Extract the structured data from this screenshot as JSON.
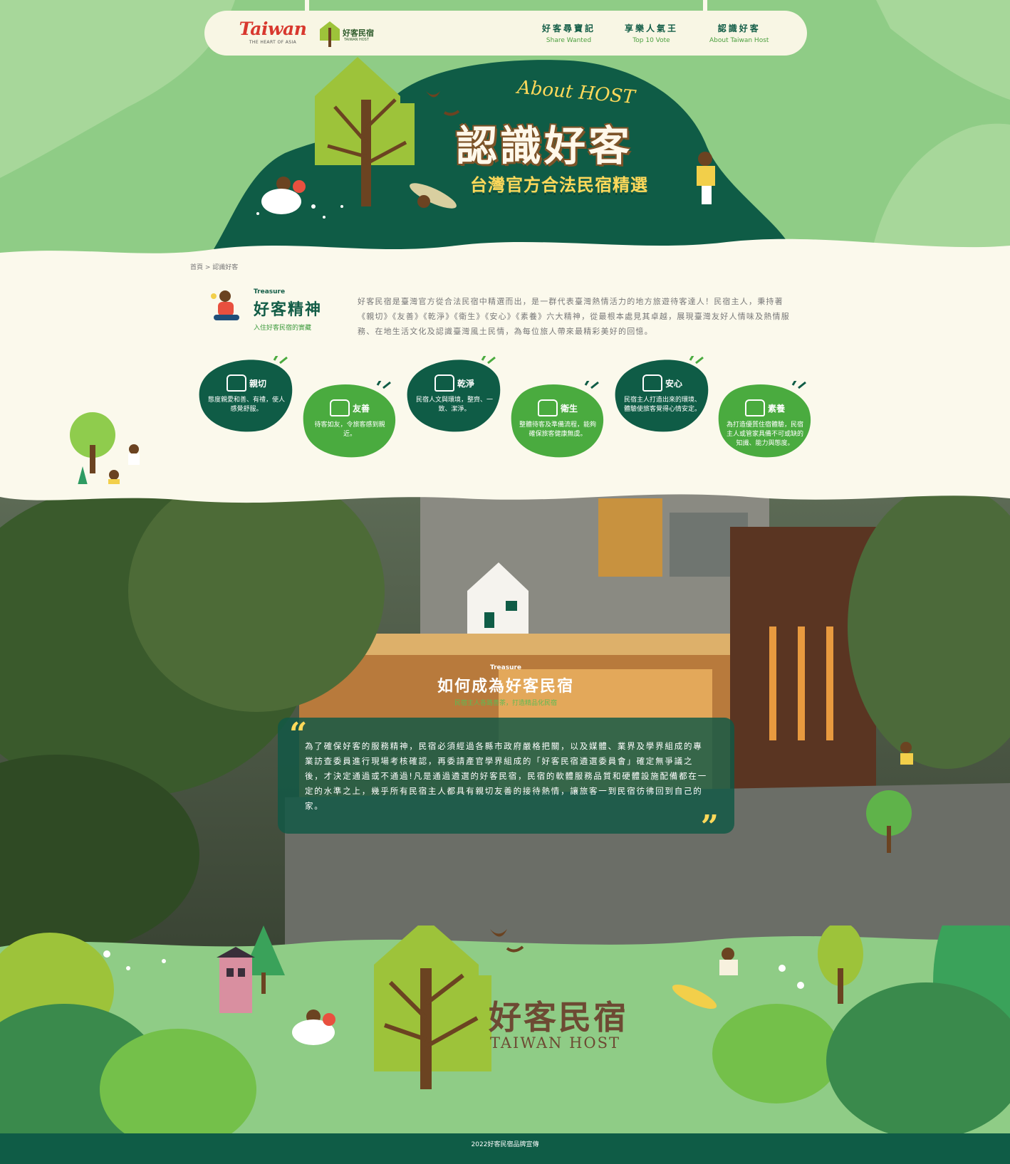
{
  "nav": {
    "logo_taiwan": "Taiwan",
    "logo_taiwan_sub": "THE HEART OF ASIA",
    "logo_host_zh": "好客民宿",
    "logo_host_en": "TAIWAN HOST",
    "items": [
      {
        "zh": "好客尋寶記",
        "en": "Share Wanted"
      },
      {
        "zh": "享樂人氣王",
        "en": "Top 10 Vote"
      },
      {
        "zh": "認識好客",
        "en": "About Taiwan Host"
      }
    ]
  },
  "hero": {
    "about": "About HOST",
    "title": "認識好客",
    "subtitle": "台灣官方合法民宿精選"
  },
  "breadcrumb": {
    "home": "首頁",
    "sep": " > ",
    "current": "認識好客"
  },
  "spirit": {
    "tag": "Treasure",
    "title": "好客精神",
    "subtitle": "入住好客民宿的實藏",
    "description": "好客民宿是臺灣官方從合法民宿中精選而出，是一群代表臺灣熱情活力的地方旅遊待客達人！民宿主人，秉持著《親切》《友善》《乾淨》《衛生》《安心》《素養》六大精神，從最根本處見其卓越，展現臺灣友好人情味及熱情服務、在地生活文化及認識臺灣風土民情，為每位旅人帶來最精彩美好的回憶。"
  },
  "values": [
    {
      "title": "親切",
      "text": "態度親愛和善、有禮，使人感覺舒服。",
      "color": "#0f5c46"
    },
    {
      "title": "友善",
      "text": "待客如友，令旅客感到親近。",
      "color": "#4aab3f"
    },
    {
      "title": "乾淨",
      "text": "民宿人文與環境，整齊、一致、潔淨。",
      "color": "#0f5c46"
    },
    {
      "title": "衛生",
      "text": "整體待客及準備流程，能夠確保旅客健康無虞。",
      "color": "#4aab3f"
    },
    {
      "title": "安心",
      "text": "民宿主人打造出來的環境、體驗使旅客覺得心情安定。",
      "color": "#0f5c46"
    },
    {
      "title": "素養",
      "text": "為打造優質住宿體驗，民宿主人或管家具備不可或缺的知識、能力與態度。",
      "color": "#4aab3f"
    }
  ],
  "how": {
    "tag": "Treasure",
    "title": "如何成為好客民宿",
    "subtitle": "民宿主人各路善茶，打造精品化民宿",
    "quote": "為了確保好客的服務精神，民宿必須經過各縣市政府嚴格把關，以及媒體、業界及學界組成的專業訪查委員進行現場考核確認，再委請產官學界組成的「好客民宿遴選委員會」確定無爭議之後，才決定通過或不通過!凡是通過遴選的好客民宿，民宿的軟體服務品質和硬體設施配備都在一定的水準之上，幾乎所有民宿主人都具有親切友善的接待熱情，讓旅客一到民宿彷彿回到自己的家。"
  },
  "bottom_logo": {
    "zh": "好客民宿",
    "en": "TAIWAN HOST"
  },
  "footer": {
    "text": "2022好客民宿品牌宣傳"
  },
  "colors": {
    "dark_green": "#0f5c46",
    "green": "#4aab3f",
    "light_green": "#8fcc86",
    "cream": "#fbf9ec",
    "accent_yellow": "#ffd95a",
    "brown": "#6d4a33"
  }
}
